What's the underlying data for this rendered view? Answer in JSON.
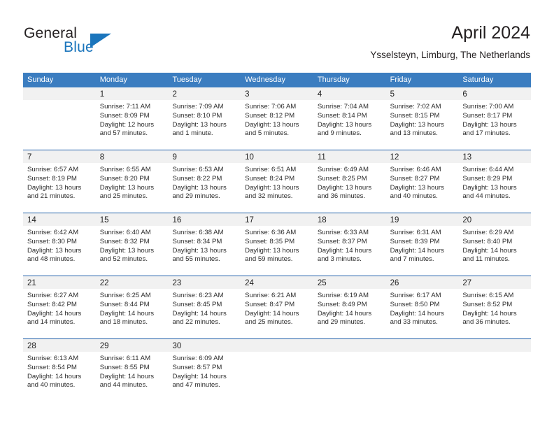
{
  "brand": {
    "name_part1": "General",
    "name_part2": "Blue",
    "triangle_icon": "brand-triangle-icon",
    "accent_color": "#1b75bc"
  },
  "header": {
    "title": "April 2024",
    "subtitle": "Ysselsteyn, Limburg, The Netherlands"
  },
  "colors": {
    "header_row_bg": "#3b7dc0",
    "week_divider": "#1f5fa9",
    "day_band_bg": "#f1f1f1",
    "text": "#222222"
  },
  "weekdays": [
    "Sunday",
    "Monday",
    "Tuesday",
    "Wednesday",
    "Thursday",
    "Friday",
    "Saturday"
  ],
  "weeks": [
    [
      {
        "day": "",
        "empty": true
      },
      {
        "day": "1",
        "sunrise": "Sunrise: 7:11 AM",
        "sunset": "Sunset: 8:09 PM",
        "daylight": "Daylight: 12 hours and 57 minutes."
      },
      {
        "day": "2",
        "sunrise": "Sunrise: 7:09 AM",
        "sunset": "Sunset: 8:10 PM",
        "daylight": "Daylight: 13 hours and 1 minute."
      },
      {
        "day": "3",
        "sunrise": "Sunrise: 7:06 AM",
        "sunset": "Sunset: 8:12 PM",
        "daylight": "Daylight: 13 hours and 5 minutes."
      },
      {
        "day": "4",
        "sunrise": "Sunrise: 7:04 AM",
        "sunset": "Sunset: 8:14 PM",
        "daylight": "Daylight: 13 hours and 9 minutes."
      },
      {
        "day": "5",
        "sunrise": "Sunrise: 7:02 AM",
        "sunset": "Sunset: 8:15 PM",
        "daylight": "Daylight: 13 hours and 13 minutes."
      },
      {
        "day": "6",
        "sunrise": "Sunrise: 7:00 AM",
        "sunset": "Sunset: 8:17 PM",
        "daylight": "Daylight: 13 hours and 17 minutes."
      }
    ],
    [
      {
        "day": "7",
        "sunrise": "Sunrise: 6:57 AM",
        "sunset": "Sunset: 8:19 PM",
        "daylight": "Daylight: 13 hours and 21 minutes."
      },
      {
        "day": "8",
        "sunrise": "Sunrise: 6:55 AM",
        "sunset": "Sunset: 8:20 PM",
        "daylight": "Daylight: 13 hours and 25 minutes."
      },
      {
        "day": "9",
        "sunrise": "Sunrise: 6:53 AM",
        "sunset": "Sunset: 8:22 PM",
        "daylight": "Daylight: 13 hours and 29 minutes."
      },
      {
        "day": "10",
        "sunrise": "Sunrise: 6:51 AM",
        "sunset": "Sunset: 8:24 PM",
        "daylight": "Daylight: 13 hours and 32 minutes."
      },
      {
        "day": "11",
        "sunrise": "Sunrise: 6:49 AM",
        "sunset": "Sunset: 8:25 PM",
        "daylight": "Daylight: 13 hours and 36 minutes."
      },
      {
        "day": "12",
        "sunrise": "Sunrise: 6:46 AM",
        "sunset": "Sunset: 8:27 PM",
        "daylight": "Daylight: 13 hours and 40 minutes."
      },
      {
        "day": "13",
        "sunrise": "Sunrise: 6:44 AM",
        "sunset": "Sunset: 8:29 PM",
        "daylight": "Daylight: 13 hours and 44 minutes."
      }
    ],
    [
      {
        "day": "14",
        "sunrise": "Sunrise: 6:42 AM",
        "sunset": "Sunset: 8:30 PM",
        "daylight": "Daylight: 13 hours and 48 minutes."
      },
      {
        "day": "15",
        "sunrise": "Sunrise: 6:40 AM",
        "sunset": "Sunset: 8:32 PM",
        "daylight": "Daylight: 13 hours and 52 minutes."
      },
      {
        "day": "16",
        "sunrise": "Sunrise: 6:38 AM",
        "sunset": "Sunset: 8:34 PM",
        "daylight": "Daylight: 13 hours and 55 minutes."
      },
      {
        "day": "17",
        "sunrise": "Sunrise: 6:36 AM",
        "sunset": "Sunset: 8:35 PM",
        "daylight": "Daylight: 13 hours and 59 minutes."
      },
      {
        "day": "18",
        "sunrise": "Sunrise: 6:33 AM",
        "sunset": "Sunset: 8:37 PM",
        "daylight": "Daylight: 14 hours and 3 minutes."
      },
      {
        "day": "19",
        "sunrise": "Sunrise: 6:31 AM",
        "sunset": "Sunset: 8:39 PM",
        "daylight": "Daylight: 14 hours and 7 minutes."
      },
      {
        "day": "20",
        "sunrise": "Sunrise: 6:29 AM",
        "sunset": "Sunset: 8:40 PM",
        "daylight": "Daylight: 14 hours and 11 minutes."
      }
    ],
    [
      {
        "day": "21",
        "sunrise": "Sunrise: 6:27 AM",
        "sunset": "Sunset: 8:42 PM",
        "daylight": "Daylight: 14 hours and 14 minutes."
      },
      {
        "day": "22",
        "sunrise": "Sunrise: 6:25 AM",
        "sunset": "Sunset: 8:44 PM",
        "daylight": "Daylight: 14 hours and 18 minutes."
      },
      {
        "day": "23",
        "sunrise": "Sunrise: 6:23 AM",
        "sunset": "Sunset: 8:45 PM",
        "daylight": "Daylight: 14 hours and 22 minutes."
      },
      {
        "day": "24",
        "sunrise": "Sunrise: 6:21 AM",
        "sunset": "Sunset: 8:47 PM",
        "daylight": "Daylight: 14 hours and 25 minutes."
      },
      {
        "day": "25",
        "sunrise": "Sunrise: 6:19 AM",
        "sunset": "Sunset: 8:49 PM",
        "daylight": "Daylight: 14 hours and 29 minutes."
      },
      {
        "day": "26",
        "sunrise": "Sunrise: 6:17 AM",
        "sunset": "Sunset: 8:50 PM",
        "daylight": "Daylight: 14 hours and 33 minutes."
      },
      {
        "day": "27",
        "sunrise": "Sunrise: 6:15 AM",
        "sunset": "Sunset: 8:52 PM",
        "daylight": "Daylight: 14 hours and 36 minutes."
      }
    ],
    [
      {
        "day": "28",
        "sunrise": "Sunrise: 6:13 AM",
        "sunset": "Sunset: 8:54 PM",
        "daylight": "Daylight: 14 hours and 40 minutes."
      },
      {
        "day": "29",
        "sunrise": "Sunrise: 6:11 AM",
        "sunset": "Sunset: 8:55 PM",
        "daylight": "Daylight: 14 hours and 44 minutes."
      },
      {
        "day": "30",
        "sunrise": "Sunrise: 6:09 AM",
        "sunset": "Sunset: 8:57 PM",
        "daylight": "Daylight: 14 hours and 47 minutes."
      },
      {
        "day": "",
        "empty": true
      },
      {
        "day": "",
        "empty": true
      },
      {
        "day": "",
        "empty": true
      },
      {
        "day": "",
        "empty": true
      }
    ]
  ]
}
